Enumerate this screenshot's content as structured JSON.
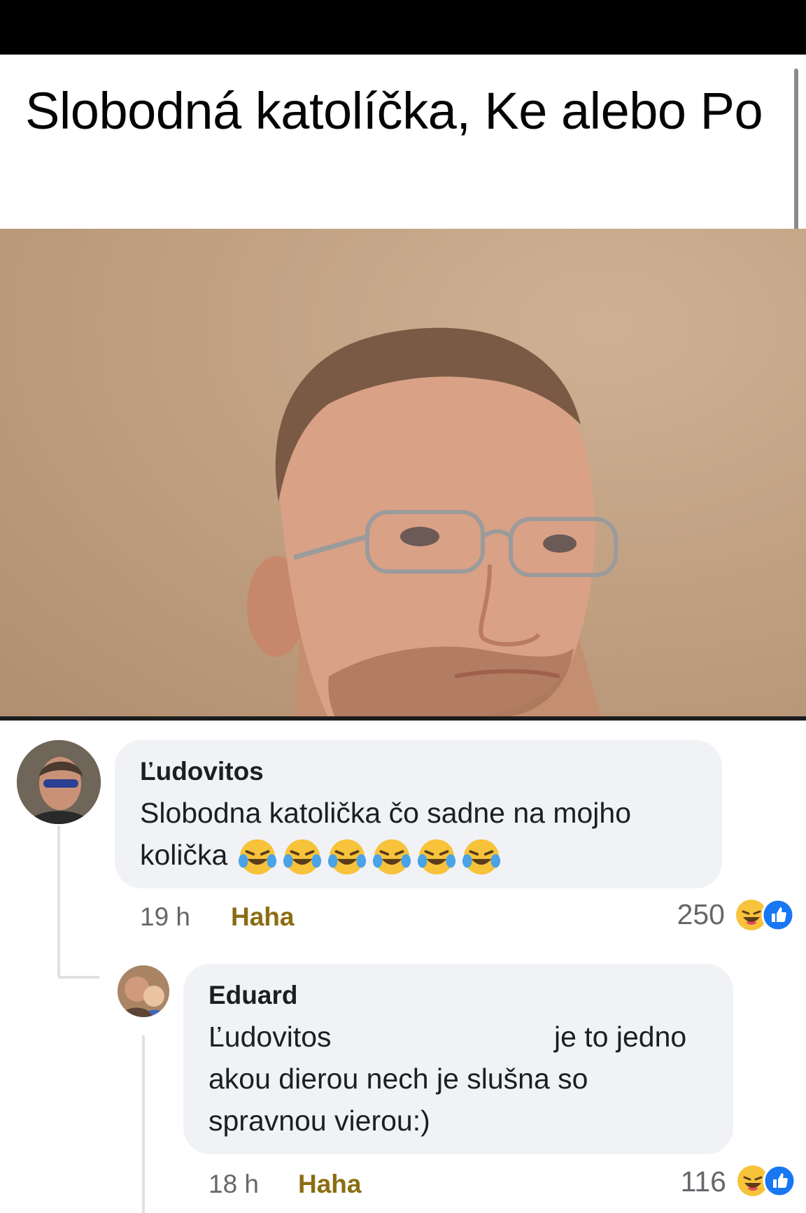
{
  "post": {
    "title": "Slobodná katolíčka, Ke alebo Po"
  },
  "comments": [
    {
      "author": "Ľudovitos",
      "line1": "Slobodna katolička čo sadne na mojho",
      "line2": "količka",
      "emoji": [
        "tears-of-joy-emoji",
        "tears-of-joy-emoji",
        "tears-of-joy-emoji",
        "tears-of-joy-emoji",
        "tears-of-joy-emoji",
        "tears-of-joy-emoji"
      ],
      "time": "19 h",
      "action": "Haha",
      "reaction_count": "250",
      "reactions": [
        "haha-reaction-icon",
        "like-reaction-icon"
      ]
    },
    {
      "author": "Eduard",
      "mention": "Ľudovitos",
      "line1_end": "je to jedno",
      "line2": "akou dierou nech je slušna so",
      "line3": "spravnou vierou:)",
      "time": "18 h",
      "action": "Haha",
      "reaction_count": "116",
      "reactions": [
        "haha-reaction-icon",
        "like-reaction-icon"
      ]
    }
  ],
  "colors": {
    "bubble": "#f0f2f5",
    "haha_action": "#8b6d12",
    "like_blue": "#1877f2",
    "haha_yellow": "#f7c33b"
  }
}
